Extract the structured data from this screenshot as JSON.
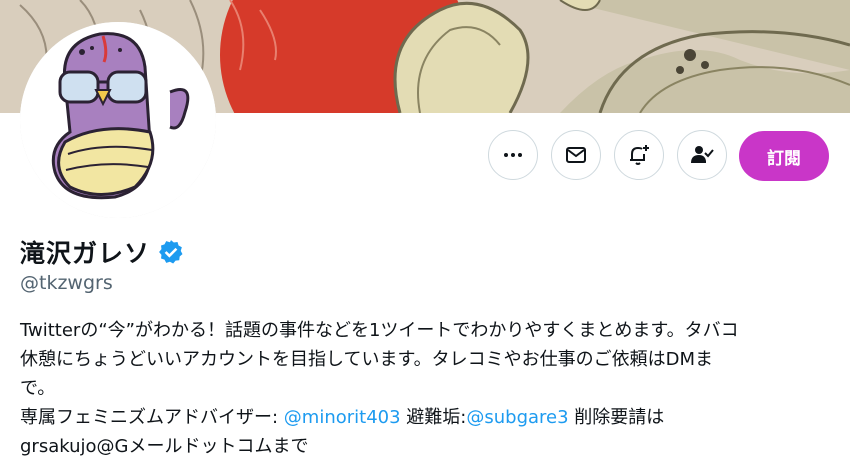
{
  "profile": {
    "display_name": "滝沢ガレソ",
    "handle": "@tkzwgrs",
    "verified_icon": "verified-badge-icon",
    "bio_line1": "Twitterの“今”がわかる！話題の事件などを1ツイートでわかりやすくまとめます。タバコ",
    "bio_line2": "休憩にちょうどいいアカウントを目指しています。タレコミやお仕事のご依頼はDMま",
    "bio_line3": "で。",
    "bio_line4_prefix": "専属フェミニズムアドバイザー: ",
    "bio_link1": "@minorit403",
    "bio_line4_mid": " 避難垢:",
    "bio_link2": "@subgare3",
    "bio_line4_suffix": " 削除要請は",
    "bio_line5": "grsakujo@Gメールドットコムまで"
  },
  "actions": {
    "more_icon": "more-icon",
    "message_icon": "mail-icon",
    "notify_icon": "bell-plus-icon",
    "following_icon": "person-check-icon",
    "subscribe_label": "訂閱"
  },
  "colors": {
    "accent": "#c936c8",
    "link": "#1d9bf0",
    "verified": "#1d9bf0",
    "secondary_text": "#536471",
    "border": "#cfd9de"
  }
}
